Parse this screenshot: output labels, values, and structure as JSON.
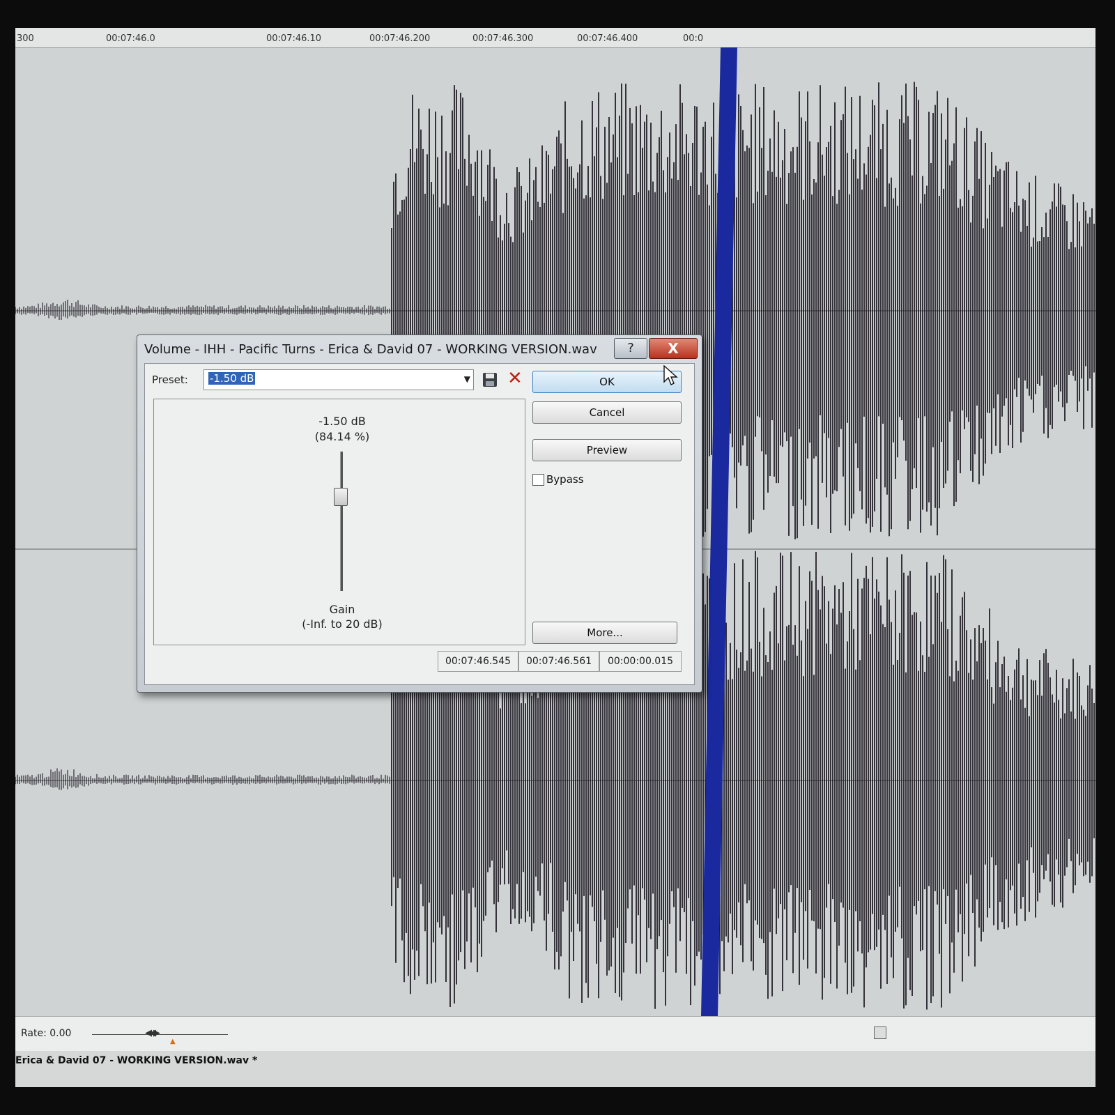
{
  "ruler": {
    "ticks": [
      "300",
      "00:07:46.0",
      "00:07:46.10",
      "00:07:46.200",
      "00:07:46.300",
      "00:07:46.400",
      "00:0"
    ]
  },
  "dialog": {
    "title": "Volume - IHH - Pacific Turns - Erica & David 07 - WORKING VERSION.wav",
    "help_label": "?",
    "close_label": "X",
    "preset_label": "Preset:",
    "preset_value": "-1.50 dB",
    "gain_db": "-1.50 dB",
    "gain_percent": "(84.14 %)",
    "gain_title": "Gain",
    "gain_range": "(-Inf. to 20 dB)",
    "gain_level_fraction": 0.32,
    "ok_label": "OK",
    "cancel_label": "Cancel",
    "preview_label": "Preview",
    "bypass_label": "Bypass",
    "bypass_checked": false,
    "more_label": "More...",
    "time_start": "00:07:46.545",
    "time_end": "00:07:46.561",
    "time_length": "00:00:00.015"
  },
  "status": {
    "rate_label": "Rate: 0.00",
    "file_label": "Erica & David 07 - WORKING VERSION.wav *"
  },
  "colors": {
    "cursor_line": "#1a2a9e",
    "waveform": "#0e0a14",
    "background": "#cfd3d3",
    "close_button": "#c0392b",
    "selection": "#2f64b8"
  },
  "icons": {
    "save": "floppy-disk-icon",
    "delete": "red-x-icon",
    "mouse": "mouse-pointer-icon"
  }
}
